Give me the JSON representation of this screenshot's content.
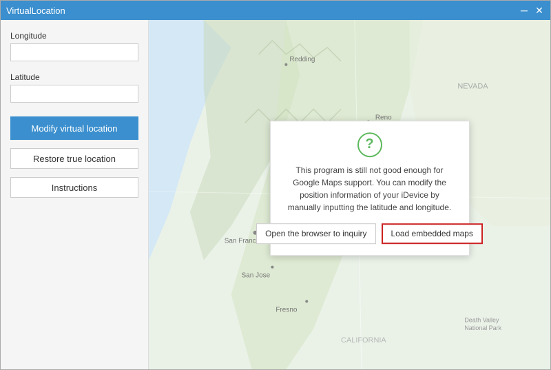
{
  "window": {
    "title": "VirtualLocation",
    "minimize_label": "─",
    "close_label": "✕"
  },
  "sidebar": {
    "longitude_label": "Longitude",
    "longitude_placeholder": "",
    "latitude_label": "Latitude",
    "latitude_placeholder": "",
    "modify_btn": "Modify virtual location",
    "restore_btn": "Restore true location",
    "instructions_btn": "Instructions"
  },
  "popup": {
    "icon": "?",
    "text": "This program is still not good enough for Google Maps support. You can modify the position information of your iDevice by manually inputting the latitude and longitude.",
    "browser_btn": "Open the browser to inquiry",
    "maps_btn": "Load embedded maps"
  },
  "map": {
    "label_nevada": "NEVADA",
    "label_california": "CALIFORNIA",
    "label_redding": "Redding",
    "label_reno": "Reno",
    "label_san_francisco": "San Francisco",
    "label_san_jose": "San Jose",
    "label_fresno": "Fresno",
    "label_death_valley": "Death Valley National Park"
  }
}
